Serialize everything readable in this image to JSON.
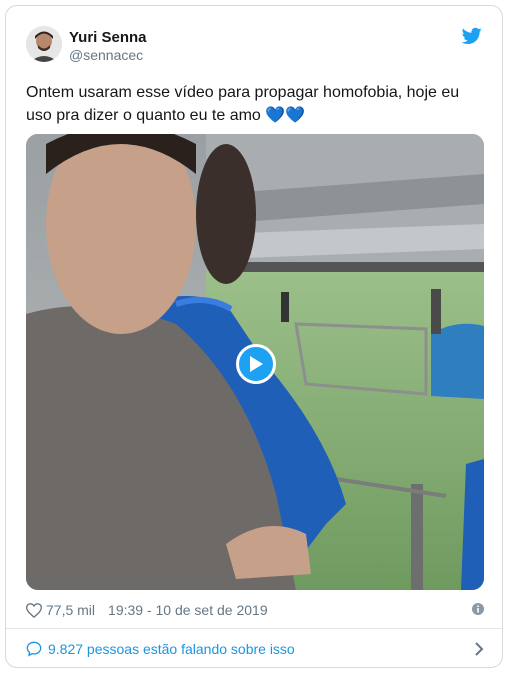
{
  "tweet": {
    "author_name": "Yuri Senna",
    "author_handle": "@sennacec",
    "text": "Ontem usaram esse vídeo para propagar homofobia, hoje eu uso pra dizer o quanto eu te amo",
    "emoji_hearts": "💙💙",
    "likes": "77,5 mil",
    "timestamp": "19:39 - 10 de set de 2019",
    "conversation_label": "9.827 pessoas estão falando sobre isso"
  },
  "icons": {
    "brand": "twitter-bird-icon",
    "like": "heart-outline-icon",
    "info": "info-icon",
    "conversation": "speech-bubble-icon",
    "chevron": "chevron-right-icon",
    "play": "play-icon"
  },
  "colors": {
    "twitter_blue": "#1da1f2",
    "link_blue": "#1b95e0",
    "secondary_text": "#657786",
    "border": "#e1e8ed"
  }
}
